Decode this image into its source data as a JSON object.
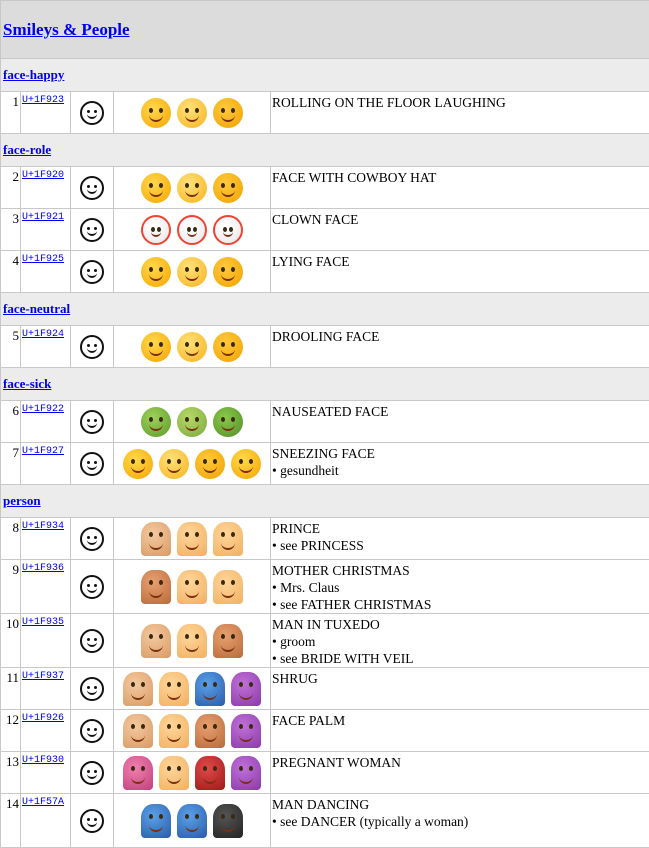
{
  "category": "Smileys & People",
  "groups": [
    {
      "subgroup": "face-happy",
      "rows": [
        {
          "num": "1",
          "code": "U+1F923",
          "name": "ROLLING ON THE FLOOR LAUGHING",
          "keywords": [],
          "icon": "rolling-laughing-face-icon"
        }
      ]
    },
    {
      "subgroup": "face-role",
      "rows": [
        {
          "num": "2",
          "code": "U+1F920",
          "name": "FACE WITH COWBOY HAT",
          "keywords": [],
          "icon": "cowboy-face-icon"
        },
        {
          "num": "3",
          "code": "U+1F921",
          "name": "CLOWN FACE",
          "keywords": [],
          "icon": "clown-face-icon"
        },
        {
          "num": "4",
          "code": "U+1F925",
          "name": "LYING FACE",
          "keywords": [],
          "icon": "lying-face-icon"
        }
      ]
    },
    {
      "subgroup": "face-neutral",
      "rows": [
        {
          "num": "5",
          "code": "U+1F924",
          "name": "DROOLING FACE",
          "keywords": [],
          "icon": "drooling-face-icon"
        }
      ]
    },
    {
      "subgroup": "face-sick",
      "rows": [
        {
          "num": "6",
          "code": "U+1F922",
          "name": "NAUSEATED FACE",
          "keywords": [],
          "icon": "nauseated-face-icon"
        },
        {
          "num": "7",
          "code": "U+1F927",
          "name": "SNEEZING FACE",
          "keywords": [
            "• gesundheit"
          ],
          "icon": "sneezing-face-icon"
        }
      ]
    },
    {
      "subgroup": "person",
      "rows": [
        {
          "num": "8",
          "code": "U+1F934",
          "name": "PRINCE",
          "keywords": [
            "• see PRINCESS"
          ],
          "icon": "prince-icon"
        },
        {
          "num": "9",
          "code": "U+1F936",
          "name": "MOTHER CHRISTMAS",
          "keywords": [
            "• Mrs. Claus",
            "• see FATHER CHRISTMAS"
          ],
          "icon": "mother-christmas-icon"
        },
        {
          "num": "10",
          "code": "U+1F935",
          "name": "MAN IN TUXEDO",
          "keywords": [
            "• groom",
            "• see BRIDE WITH VEIL"
          ],
          "icon": "man-in-tuxedo-icon"
        },
        {
          "num": "11",
          "code": "U+1F937",
          "name": "SHRUG",
          "keywords": [],
          "icon": "shrug-icon"
        },
        {
          "num": "12",
          "code": "U+1F926",
          "name": "FACE PALM",
          "keywords": [],
          "icon": "face-palm-icon"
        },
        {
          "num": "13",
          "code": "U+1F930",
          "name": "PREGNANT WOMAN",
          "keywords": [],
          "icon": "pregnant-woman-icon"
        },
        {
          "num": "14",
          "code": "U+1F57A",
          "name": "MAN DANCING",
          "keywords": [
            "• see DANCER (typically a woman)"
          ],
          "icon": "man-dancing-icon"
        }
      ]
    }
  ],
  "colors": {
    "header_bg": "#dcdcdc",
    "subheader_bg": "#ececec",
    "link": "#0000ee",
    "border": "#c8c8c8"
  }
}
